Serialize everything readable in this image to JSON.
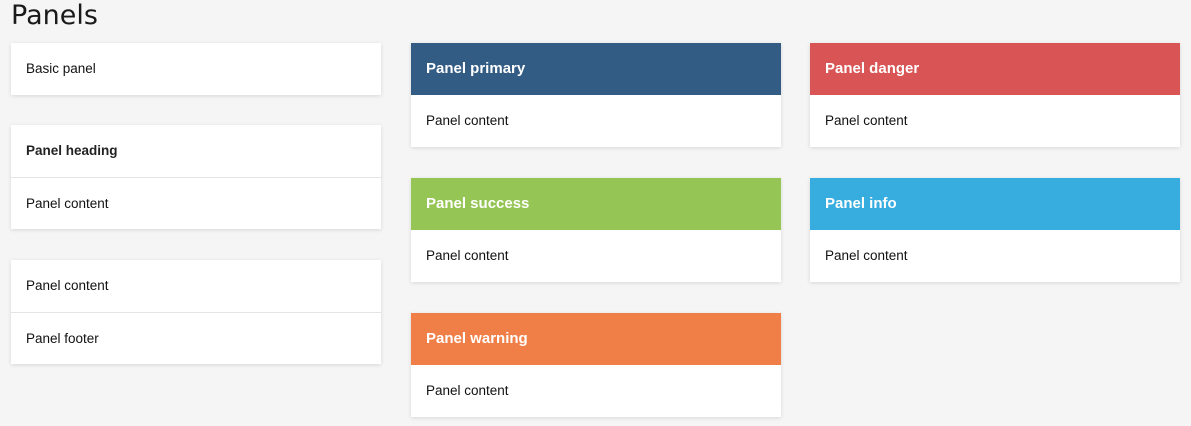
{
  "page": {
    "title": "Panels"
  },
  "panels": {
    "basic": {
      "content": "Basic panel"
    },
    "with_heading": {
      "heading": "Panel heading",
      "content": "Panel content"
    },
    "with_footer": {
      "content": "Panel content",
      "footer": "Panel footer"
    },
    "primary": {
      "heading": "Panel primary",
      "content": "Panel content",
      "color": "#335c85"
    },
    "success": {
      "heading": "Panel success",
      "content": "Panel content",
      "color": "#95c555"
    },
    "warning": {
      "heading": "Panel warning",
      "content": "Panel content",
      "color": "#f07f47"
    },
    "danger": {
      "heading": "Panel danger",
      "content": "Panel content",
      "color": "#d95454"
    },
    "info": {
      "heading": "Panel info",
      "content": "Panel content",
      "color": "#36acdf"
    }
  }
}
